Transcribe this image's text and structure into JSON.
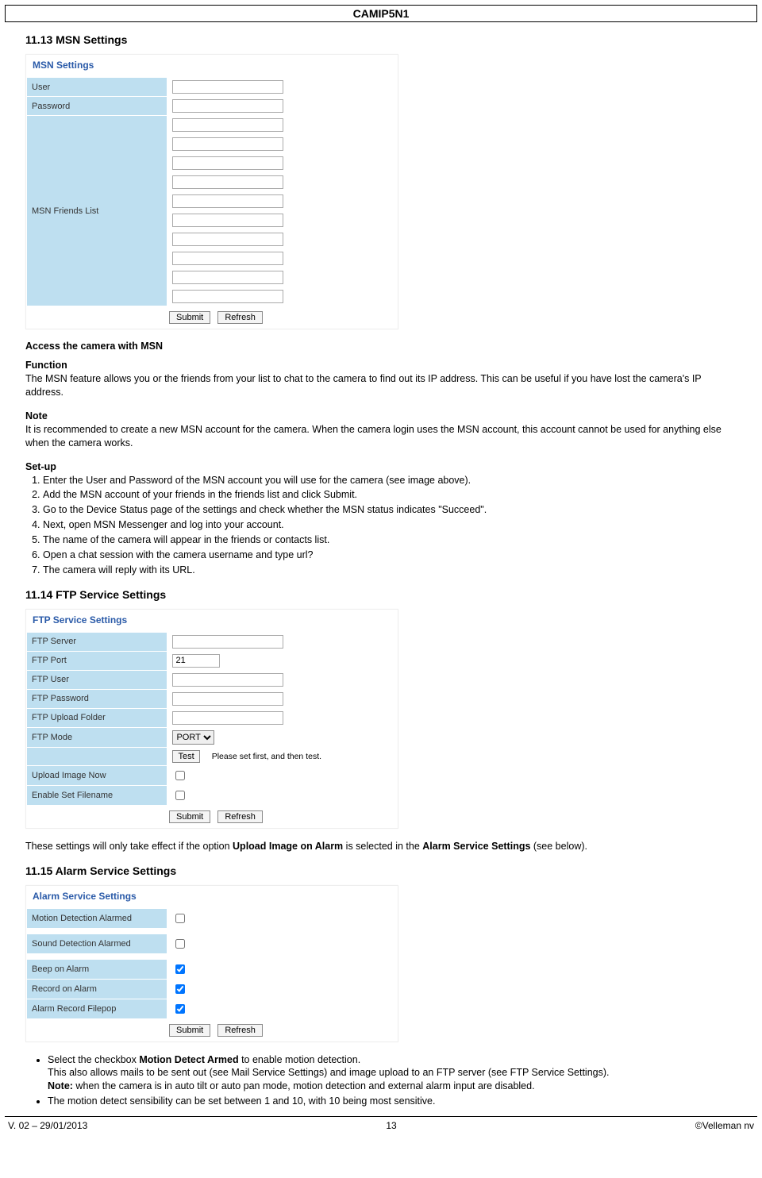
{
  "header": {
    "title": "CAMIP5N1"
  },
  "sections": {
    "s1113": "11.13 MSN Settings",
    "s1114": "11.14 FTP Service Settings",
    "s1115": "11.15 Alarm Service Settings"
  },
  "msn_panel": {
    "title": "MSN Settings",
    "labels": {
      "user": "User",
      "password": "Password",
      "friends": "MSN Friends List"
    },
    "buttons": {
      "submit": "Submit",
      "refresh": "Refresh"
    }
  },
  "msn_text": {
    "access_h": "Access the camera with MSN",
    "function_h": "Function",
    "function_p1": "The MSN feature allows you or the friends from your list to chat to the camera to find out its IP address. This can be useful if you have lost the camera's IP address.",
    "note_h": "Note",
    "note_p1": "It is recommended to create a new MSN account for the camera. When the camera login uses the MSN account, this account cannot be used for anything else when the camera works.",
    "setup_h": "Set-up",
    "setup_items": [
      "Enter the User and Password of the MSN account you will use for the camera (see image above).",
      "Add the MSN account of your friends in the friends list and click Submit.",
      "Go to the Device Status page of the settings and check whether the MSN status indicates \"Succeed\".",
      "Next, open MSN Messenger and log into your account.",
      "The name of the camera will appear in the friends or contacts list.",
      "Open a chat session with the camera username and type url?",
      "The camera will reply with its URL."
    ]
  },
  "ftp_panel": {
    "title": "FTP Service Settings",
    "labels": {
      "server": "FTP Server",
      "port": "FTP Port",
      "user": "FTP User",
      "password": "FTP Password",
      "folder": "FTP Upload Folder",
      "mode": "FTP Mode",
      "upload_now": "Upload Image Now",
      "enable_fn": "Enable Set Filename"
    },
    "values": {
      "port": "21",
      "mode": "PORT",
      "test_note": "Please set first, and then test."
    },
    "buttons": {
      "test": "Test",
      "submit": "Submit",
      "refresh": "Refresh"
    }
  },
  "ftp_note": {
    "pre": "These settings will only take effect if the option ",
    "b1": "Upload Image on Alarm",
    "mid": " is selected in the ",
    "b2": "Alarm Service Settings",
    "post": " (see below)."
  },
  "alarm_panel": {
    "title": "Alarm Service Settings",
    "labels": {
      "motion": "Motion Detection Alarmed",
      "sound": "Sound Detection Alarmed",
      "beep": "Beep on Alarm",
      "record": "Record on Alarm",
      "filepop": "Alarm Record Filepop"
    },
    "buttons": {
      "submit": "Submit",
      "refresh": "Refresh"
    }
  },
  "alarm_bullets": {
    "b1_pre": "Select the checkbox ",
    "b1_bold": "Motion Detect Armed",
    "b1_post": " to enable motion detection.",
    "b1_line2": "This also allows mails to be sent out (see Mail Service Settings) and image upload to an FTP server (see FTP Service Settings).",
    "b1_note_label": "Note:",
    "b1_note_text": " when the camera is in auto tilt or auto pan mode, motion detection and external alarm input are disabled.",
    "b2": "The motion detect sensibility can be set between 1 and 10, with 10 being most sensitive."
  },
  "footer": {
    "left": "V. 02 – 29/01/2013",
    "center": "13",
    "right": "©Velleman nv"
  }
}
